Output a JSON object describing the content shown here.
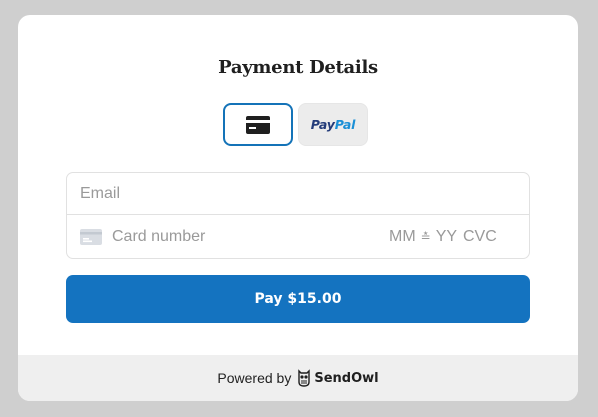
{
  "form": {
    "title": "Payment Details",
    "payment_methods": [
      {
        "name": "card",
        "icon": "credit-card-icon",
        "selected": true
      },
      {
        "name": "paypal",
        "label_part1": "Pay",
        "label_part2": "Pal",
        "selected": false
      }
    ],
    "email": {
      "value": "",
      "placeholder": "Email"
    },
    "card_number": {
      "value": "",
      "placeholder": "Card number"
    },
    "expiry": {
      "mm": "MM",
      "separator": "≛",
      "yy": "YY"
    },
    "cvc": {
      "placeholder": "CVC"
    },
    "pay_button_label": "Pay $15.00"
  },
  "footer": {
    "powered_by": "Powered by",
    "brand": "SendOwl",
    "brand_icon": "owl-icon"
  },
  "colors": {
    "accent": "#1473c0",
    "page_background": "#cfcfcf",
    "footer_background": "#efefef",
    "paypal_dark": "#243c7a",
    "paypal_light": "#1a8fd6"
  }
}
